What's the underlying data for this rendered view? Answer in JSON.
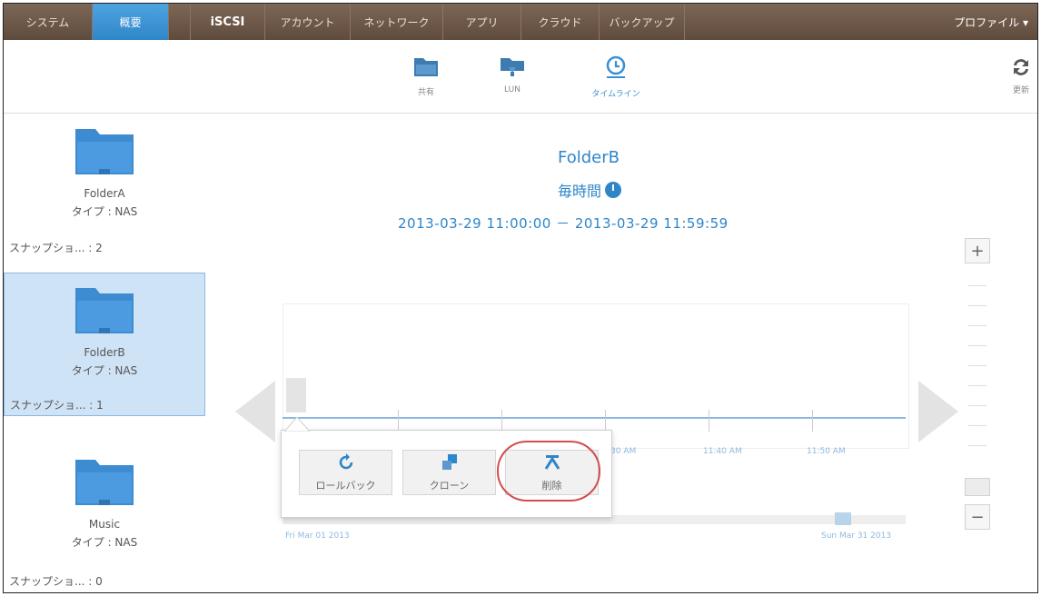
{
  "nav": {
    "items": [
      "システム",
      "概要",
      "iSCSI",
      "アカウント",
      "ネットワーク",
      "アプリ",
      "クラウド",
      "バックアップ"
    ],
    "profile": "プロファイル ▾"
  },
  "toolbar": {
    "share_label": "共有",
    "lun_label": "LUN",
    "timeline_label": "タイムライン",
    "refresh_label": "更新"
  },
  "sidebar": {
    "volumes": [
      {
        "name": "FolderA",
        "type": "タイプ : NAS",
        "snapshots": "スナップショ... : 2"
      },
      {
        "name": "FolderB",
        "type": "タイプ : NAS",
        "snapshots": "スナップショ... : 1"
      },
      {
        "name": "Music",
        "type": "タイプ : NAS",
        "snapshots": "スナップショ... : 0"
      }
    ]
  },
  "main": {
    "folder_title": "FolderB",
    "frequency": "毎時間",
    "range": "2013-03-29 11:00:00 － 2013-03-29 11:59:59",
    "tick_labels": [
      "30 AM",
      "11:40 AM",
      "11:50 AM"
    ],
    "scroll_start": "Fri Mar 01 2013",
    "scroll_end": "Sun Mar 31 2013"
  },
  "popup": {
    "rollback_label": "ロールバック",
    "clone_label": "クローン",
    "delete_label": "削除"
  },
  "zoom": {
    "plus": "+",
    "minus": "−"
  }
}
